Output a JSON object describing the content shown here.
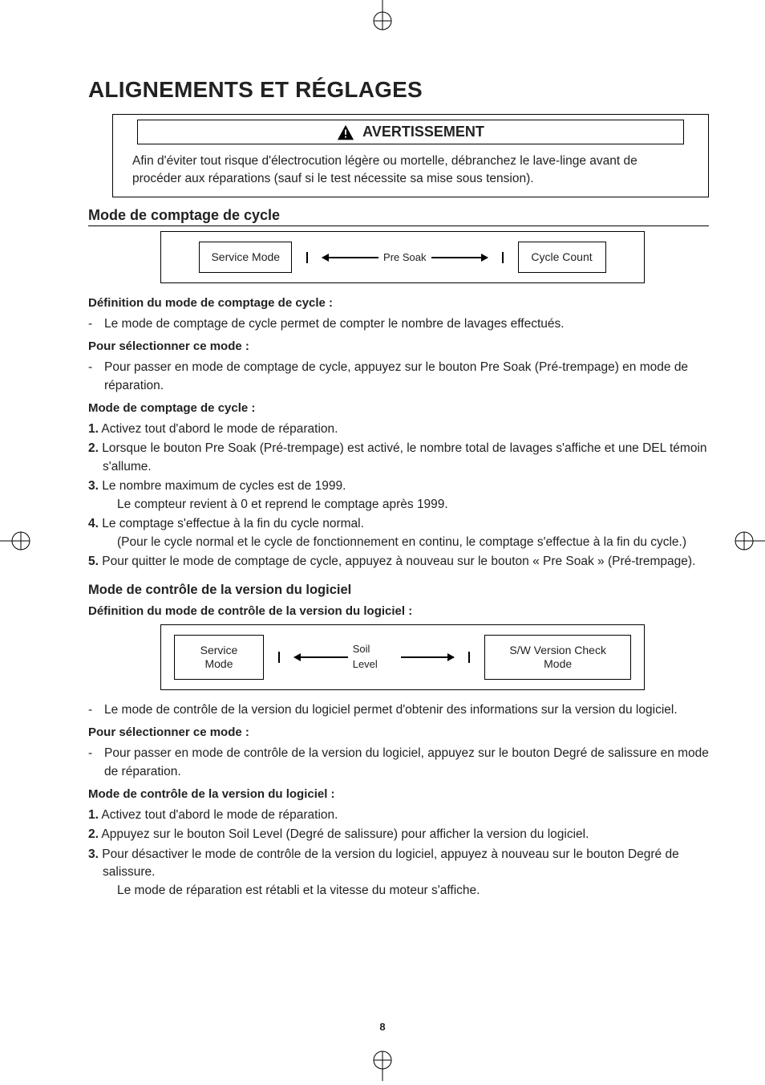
{
  "page_title": "ALIGNEMENTS ET RÉGLAGES",
  "warning": {
    "header": "AVERTISSEMENT",
    "body": "Afin d'éviter tout risque d'électrocution légère ou mortelle, débranchez le lave-linge avant de procéder aux réparations (sauf si le test nécessite sa mise sous tension)."
  },
  "section1": {
    "heading": "Mode de comptage de cycle",
    "diagram": {
      "box_left": "Service Mode",
      "label": "Pre Soak",
      "box_right": "Cycle Count"
    },
    "def_heading": "Définition du mode de comptage de cycle :",
    "def_text": "Le mode de comptage de cycle permet de compter le nombre de lavages effectués.",
    "select_heading": "Pour sélectionner ce mode :",
    "select_text": "Pour passer en mode de comptage de cycle, appuyez sur le bouton Pre Soak (Pré-trempage) en mode de réparation.",
    "mode_heading": "Mode de comptage de cycle :",
    "steps": {
      "s1": "Activez tout d'abord le mode de réparation.",
      "s2": "Lorsque le bouton Pre Soak (Pré-trempage) est activé, le nombre total de lavages s'affiche et une DEL témoin s'allume.",
      "s3a": "Le nombre maximum de cycles est de 1999.",
      "s3b": "Le compteur revient à 0 et reprend le comptage après 1999.",
      "s4a": "Le comptage s'effectue à la fin du cycle normal.",
      "s4b": "(Pour le cycle normal et le cycle de fonctionnement en continu, le comptage s'effectue à la fin du cycle.)",
      "s5": "Pour quitter le mode de comptage de cycle, appuyez à nouveau sur le bouton « Pre Soak » (Pré-trempage)."
    }
  },
  "section2": {
    "heading": "Mode de contrôle de la version du logiciel",
    "def_heading": "Définition du mode de contrôle de la version du logiciel :",
    "diagram": {
      "box_left": "Service Mode",
      "label": "Soil Level",
      "box_right": "S/W Version Check Mode"
    },
    "def_text": "Le mode de contrôle de la version du logiciel permet d'obtenir des informations sur la version du logiciel.",
    "select_heading": "Pour sélectionner ce mode :",
    "select_text": "Pour passer en mode de contrôle de la version du logiciel, appuyez sur le bouton Degré de salissure en mode de réparation.",
    "mode_heading": "Mode de contrôle de la version du logiciel :",
    "steps": {
      "s1": "Activez tout d'abord le mode de réparation.",
      "s2": "Appuyez sur le bouton Soil Level (Degré de salissure) pour afficher la version du logiciel.",
      "s3a": "Pour désactiver le mode de contrôle de la version du logiciel, appuyez à nouveau sur le bouton Degré de salissure.",
      "s3b": "Le mode de réparation est rétabli et la vitesse du moteur s'affiche."
    }
  },
  "nums": {
    "n1": "1.",
    "n2": "2.",
    "n3": "3.",
    "n4": "4.",
    "n5": "5."
  },
  "dash": "-",
  "page_number": "8"
}
